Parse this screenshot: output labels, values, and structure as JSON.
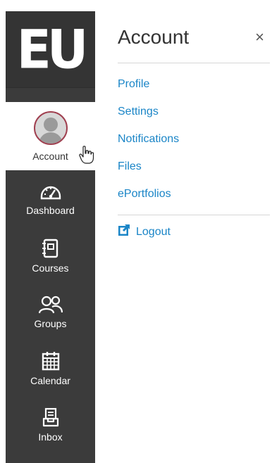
{
  "logo": {
    "text": "EU"
  },
  "nav": {
    "items": [
      {
        "label": "Account",
        "icon": "avatar",
        "active": true
      },
      {
        "label": "Dashboard",
        "icon": "dashboard-icon"
      },
      {
        "label": "Courses",
        "icon": "courses-icon"
      },
      {
        "label": "Groups",
        "icon": "groups-icon"
      },
      {
        "label": "Calendar",
        "icon": "calendar-icon"
      },
      {
        "label": "Inbox",
        "icon": "inbox-icon"
      }
    ]
  },
  "panel": {
    "title": "Account",
    "close_label": "×",
    "links": [
      {
        "label": "Profile"
      },
      {
        "label": "Settings"
      },
      {
        "label": "Notifications"
      },
      {
        "label": "Files"
      },
      {
        "label": "ePortfolios"
      }
    ],
    "logout_label": "Logout"
  },
  "colors": {
    "nav_bg": "#3b3b3b",
    "link": "#1a85c7",
    "avatar_border": "#a04050"
  }
}
